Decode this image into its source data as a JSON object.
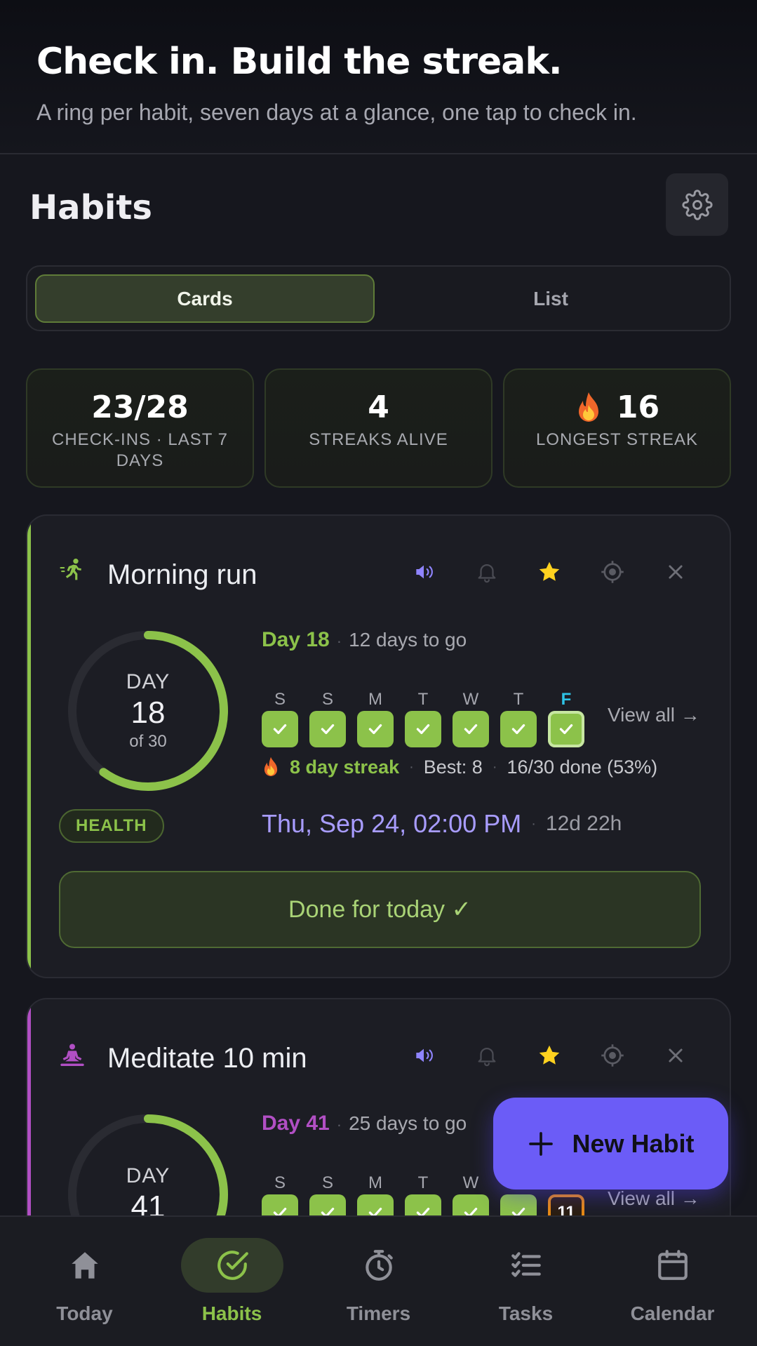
{
  "banner": {
    "title": "Check in. Build the streak.",
    "subtitle": "A ring per habit, seven days at a glance, one tap to check in."
  },
  "header": {
    "title": "Habits",
    "settings_icon": "gear-icon"
  },
  "view_toggle": {
    "cards_label": "Cards",
    "list_label": "List",
    "selected": "Cards"
  },
  "stats": [
    {
      "value": "23/28",
      "label": "CHECK-INS · LAST 7 DAYS"
    },
    {
      "value": "4",
      "label": "STREAKS ALIVE"
    },
    {
      "value": "16",
      "label": "LONGEST STREAK",
      "icon": "flame-icon"
    }
  ],
  "habits": [
    {
      "name": "Morning run",
      "icon": "running-icon",
      "accent": "#8cc24a",
      "ring": {
        "day_label": "DAY",
        "day": "18",
        "of_label": "of 30",
        "progress": 0.6
      },
      "day_text": "Day 18",
      "days_to_go": "12 days to go",
      "week_letters": [
        "S",
        "S",
        "M",
        "T",
        "W",
        "T",
        "F"
      ],
      "week_done": [
        true,
        true,
        true,
        true,
        true,
        true,
        true
      ],
      "today_index": 6,
      "view_all": "View all →",
      "streak": "8 day streak",
      "best": "Best: 8",
      "done_summary": "16/30 done (53%)",
      "tag": "HEALTH",
      "next_date": "Thu, Sep 24, 02:00 PM",
      "time_left": "12d 22h",
      "done_button": "Done for today ✓"
    },
    {
      "name": "Meditate 10 min",
      "icon": "meditation-icon",
      "accent": "#b14fc4",
      "ring": {
        "day_label": "DAY",
        "day": "41",
        "progress": 0.6
      },
      "day_text": "Day 41",
      "days_to_go": "25 days to go",
      "week_letters": [
        "S",
        "S",
        "M",
        "T",
        "W",
        "T"
      ],
      "today_number": "11",
      "view_all": "View all →"
    }
  ],
  "fab": {
    "label": "New Habit"
  },
  "nav": [
    {
      "label": "Today",
      "icon": "home-icon"
    },
    {
      "label": "Habits",
      "icon": "check-circle-icon",
      "active": true
    },
    {
      "label": "Timers",
      "icon": "stopwatch-icon"
    },
    {
      "label": "Tasks",
      "icon": "checklist-icon"
    },
    {
      "label": "Calendar",
      "icon": "calendar-icon"
    }
  ],
  "colors": {
    "accent_green": "#8cc24a",
    "accent_purple": "#6b5cf7",
    "date_purple": "#a89cff",
    "star": "#ffd21f"
  }
}
